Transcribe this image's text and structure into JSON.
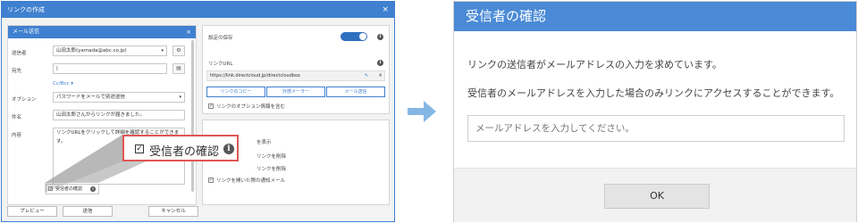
{
  "left_dialog": {
    "title": "リンクの作成",
    "close": "×",
    "email_panel": {
      "header": "メール送信",
      "close": "×",
      "sender_label": "送信者",
      "sender_value": "山田太郎(yamada@abc.co.jp)",
      "to_label": "宛先",
      "to_value": "|",
      "ccbcc_link": "Cc/Bcc ▾",
      "option_label": "オプション",
      "option_value": "パスワードをメールで別途送信",
      "subject_label": "件名",
      "subject_value": "山田太郎さんからリンクが届きました。",
      "body_label": "内容",
      "body_value": "リンクURLをクリックして詳細を確認することができます。",
      "confirm_small": "受信者の確認"
    },
    "settings": {
      "save_label": "設定の保存",
      "link_url_label": "リンクURL",
      "url_value": "https://link.directcloud.jp/directcloudbox",
      "pencil": "✎",
      "count": "4",
      "copy_btn": "リンクのコピー",
      "external_btn": "外部メーラー",
      "mail_btn": "メール送信",
      "option_info": "リンクのオプション情報を含む"
    },
    "options_lower": {
      "opt1": "を表示",
      "opt2": "リンクを削除",
      "opt3": "リンクを削除",
      "opt4": "リンクを開いた際の通知メール"
    },
    "callout": {
      "label": "受信者の確認",
      "info": "i",
      "check": "✓"
    },
    "footer": {
      "preview": "プレビュー",
      "send": "送信",
      "cancel": "キャンセル"
    }
  },
  "modal": {
    "title": "受信者の確認",
    "line1": "リンクの送信者がメールアドレスの入力を求めています。",
    "line2": "受信者のメールアドレスを入力した場合のみリンクにアクセスすることができます。",
    "email_placeholder": "メールアドレスを入力してください。",
    "ok_button": "OK"
  },
  "colors": {
    "accent": "#3f80d0",
    "modal_header": "#4a8ad6",
    "callout_border": "#e05555",
    "arrow": "#86b7e4"
  },
  "icons": {
    "gear": "gear-icon",
    "save": "save-icon",
    "info": "info-icon",
    "arrow": "arrow-right-icon"
  }
}
